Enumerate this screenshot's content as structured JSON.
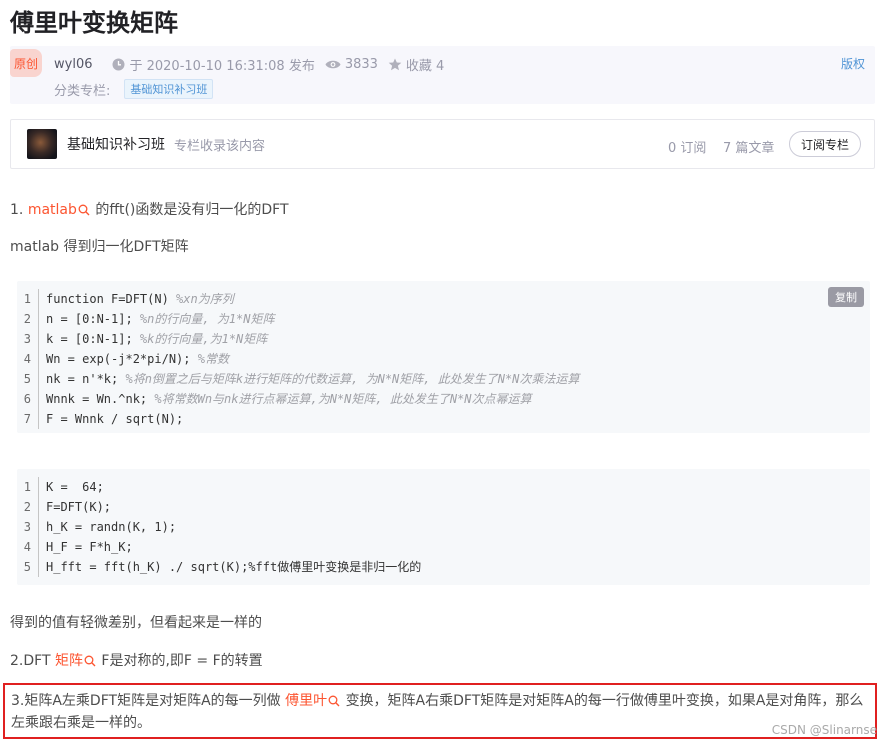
{
  "article": {
    "title": "傅里叶变换矩阵",
    "badge": "原创",
    "author": "wyl06",
    "datetime": "于 2020-10-10 16:31:08 发布",
    "views": "3833",
    "favorites": "收藏 4",
    "category_label": "分类专栏:",
    "category_tag": "基础知识补习班",
    "copyright": "版权"
  },
  "column": {
    "name": "基础知识补习班",
    "desc": "专栏收录该内容",
    "subscribers": "0 订阅",
    "articles": "7 篇文章",
    "subscribe_button": "订阅专栏"
  },
  "content": {
    "p1_prefix": "1.",
    "p1_link": "matlab",
    "p1_rest": "的fft()函数是没有归一化的DFT",
    "p2": "matlab 得到归一化DFT矩阵",
    "copy_button": "复制",
    "code1": [
      {
        "n": "1",
        "code": "function F=DFT(N) ",
        "comment": "%xn为序列"
      },
      {
        "n": "2",
        "code": "n = [0:N-1]; ",
        "comment": "%n的行向量, 为1*N矩阵"
      },
      {
        "n": "3",
        "code": "k = [0:N-1]; ",
        "comment": "%k的行向量,为1*N矩阵"
      },
      {
        "n": "4",
        "code": "Wn = exp(-j*2*pi/N); ",
        "comment": "%常数"
      },
      {
        "n": "5",
        "code": "nk = n'*k; ",
        "comment": "%将n倒置之后与矩阵k进行矩阵的代数运算, 为N*N矩阵, 此处发生了N*N次乘法运算"
      },
      {
        "n": "6",
        "code": "Wnnk = Wn.^nk; ",
        "comment": "%将常数Wn与nk进行点幂运算,为N*N矩阵, 此处发生了N*N次点幂运算"
      },
      {
        "n": "7",
        "code": "F = Wnnk / sqrt(N);",
        "comment": ""
      }
    ],
    "code2": [
      {
        "n": "1",
        "code": "K =  64;"
      },
      {
        "n": "2",
        "code": "F=DFT(K);"
      },
      {
        "n": "3",
        "code": "h_K = randn(K, 1);"
      },
      {
        "n": "4",
        "code": "H_F = F*h_K;"
      },
      {
        "n": "5",
        "code": "H_fft = fft(h_K) ./ sqrt(K);%fft做傅里叶变换是非归一化的"
      }
    ],
    "p3": "得到的值有轻微差别，但看起来是一样的",
    "p4_prefix": "2.DFT",
    "p4_link": "矩阵",
    "p4_rest": "F是对称的,即F = F的转置",
    "p5_prefix": "3.矩阵A左乘DFT矩阵是对矩阵A的每一列做",
    "p5_link": "傅里叶",
    "p5_rest": "变换，矩阵A右乘DFT矩阵是对矩阵A的每一行做傅里叶变换，如果A是对角阵，那么左乘跟右乘是一样的。",
    "watermark": "CSDN @Slinarnse"
  }
}
